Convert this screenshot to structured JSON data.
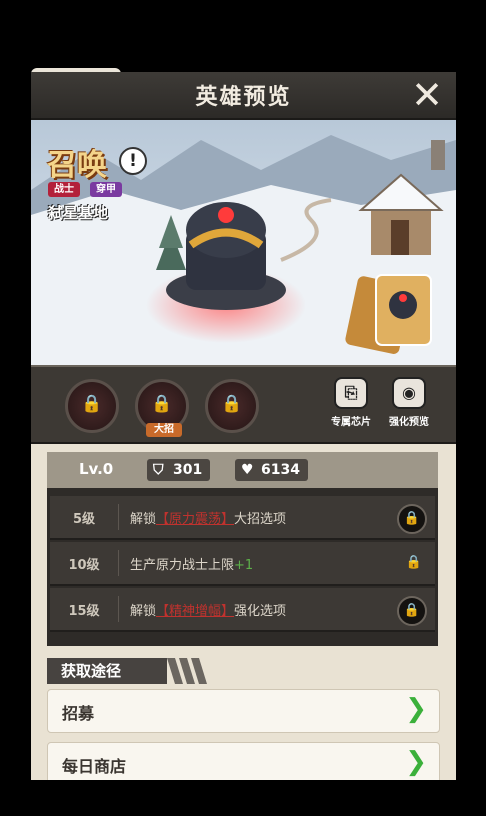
{
  "header": {
    "title": "英雄预览",
    "close_glyph": "✕"
  },
  "hero": {
    "name": "召唤",
    "warn_glyph": "!",
    "tags": [
      "战士",
      "穿甲"
    ],
    "location": "弑星基地"
  },
  "skills": {
    "lock_glyph": "🔒",
    "ultimate_badge": "大招",
    "buttons": [
      {
        "label": "专属芯片",
        "icon": "chip-icon"
      },
      {
        "label": "强化预览",
        "icon": "eye-icon"
      }
    ]
  },
  "stats": {
    "level": "Lv.0",
    "defense": "301",
    "hp": "6134"
  },
  "level_rows": [
    {
      "level": "5级",
      "prefix": "解锁",
      "highlight": "【原力震荡】",
      "suffix": "大招选项"
    },
    {
      "level": "10级",
      "prefix": "生产原力战士上限",
      "plus": "+1"
    },
    {
      "level": "15级",
      "prefix": "解锁",
      "highlight": "【精神增幅】",
      "suffix": "强化选项"
    }
  ],
  "sources": {
    "title": "获取途径",
    "items": [
      "招募",
      "每日商店"
    ]
  },
  "colors": {
    "accent_gold": "#f4d48a",
    "highlight_red": "#c0322e",
    "plus_green": "#5db04a",
    "arrow_green": "#3bb03a"
  }
}
